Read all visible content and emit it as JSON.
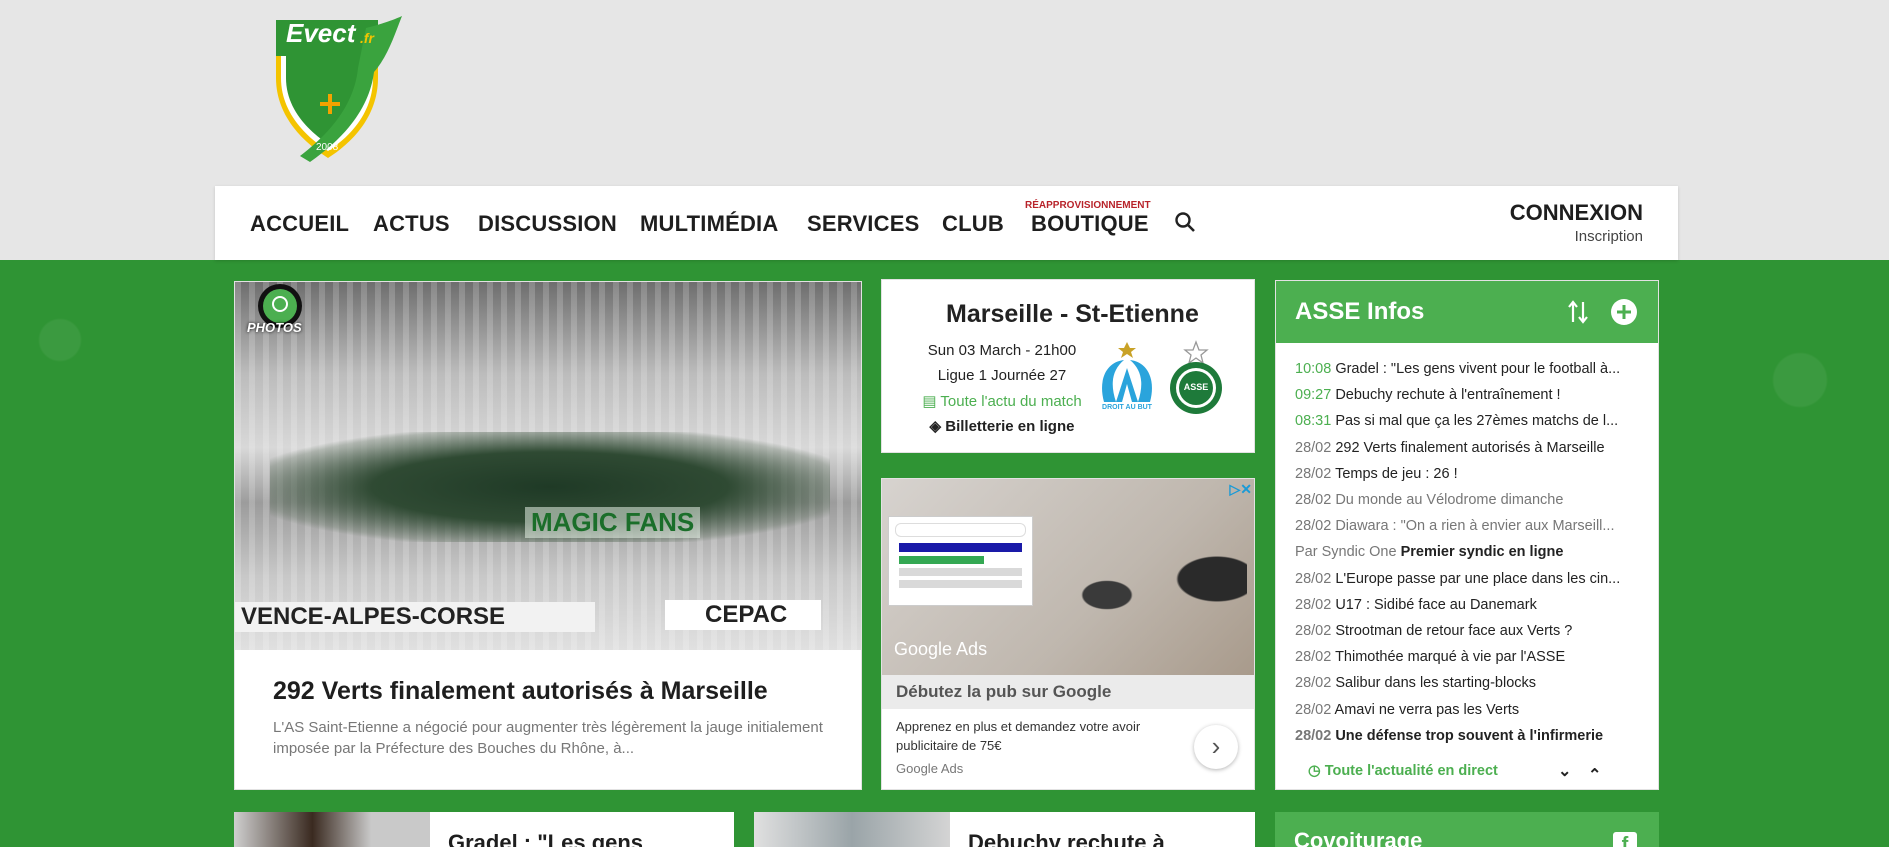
{
  "logo": {
    "text": "Evect",
    "suffix": ".fr",
    "year": "2008"
  },
  "nav": {
    "items": [
      "ACCUEIL",
      "ACTUS",
      "DISCUSSION",
      "MULTIMÉDIA",
      "SERVICES",
      "CLUB",
      "BOUTIQUE"
    ],
    "boutique_badge": "RÉAPPROVISIONNEMENT",
    "login": "CONNEXION",
    "register": "Inscription"
  },
  "featured": {
    "badge": "PHOTOS",
    "banner_left": "VENCE-ALPES-CORSE",
    "banner_right": "CEPAC",
    "crowd_banner": "MAGIC FANS",
    "title": "292 Verts finalement autorisés à Marseille",
    "description": "L'AS Saint-Etienne a négocié pour augmenter très légèrement la jauge initialement imposée par la Préfecture des Bouches du Rhône, à..."
  },
  "match": {
    "title": "Marseille - St-Etienne",
    "date": "Sun 03 March - 21h00",
    "competition": "Ligue 1 Journée 27",
    "news_link": "Toute l'actu du match",
    "ticket_link": "Billetterie en ligne",
    "home_logo_caption": "DROIT AU BUT",
    "away_logo_caption": "ASSE"
  },
  "ad": {
    "brand": "Google Ads",
    "headline": "Débutez la pub sur Google",
    "text": "Apprenez en plus et demandez votre avoir publicitaire de 75€",
    "source": "Google Ads"
  },
  "infos": {
    "title": "ASSE Infos",
    "items": [
      {
        "time": "10:08",
        "title": "Gradel : \"Les gens vivent pour le football à...",
        "green": true
      },
      {
        "time": "09:27",
        "title": "Debuchy rechute à l'entraînement !",
        "green": true
      },
      {
        "time": "08:31",
        "title": "Pas si mal que ça les 27èmes matchs de l...",
        "green": true
      },
      {
        "time": "28/02",
        "title": "292 Verts finalement autorisés à Marseille"
      },
      {
        "time": "28/02",
        "title": "Temps de jeu : 26 !"
      },
      {
        "time": "28/02",
        "title": "Du monde au Vélodrome dimanche",
        "grey": true
      },
      {
        "time": "28/02",
        "title": "Diawara : \"On a rien à envier aux Marseill...",
        "grey": true
      },
      {
        "time": "Par Syndic One",
        "title": "Premier syndic en ligne",
        "sponsor": true
      },
      {
        "time": "28/02",
        "title": "L'Europe passe par une place dans les cin..."
      },
      {
        "time": "28/02",
        "title": "U17 : Sidibé face au Danemark"
      },
      {
        "time": "28/02",
        "title": "Strootman de retour face aux Verts ?"
      },
      {
        "time": "28/02",
        "title": "Thimothée marqué à vie par l'ASSE"
      },
      {
        "time": "28/02",
        "title": "Salibur dans les starting-blocks"
      },
      {
        "time": "28/02",
        "title": "Amavi ne verra pas les Verts"
      },
      {
        "time": "28/02",
        "title": "Une défense trop souvent à l'infirmerie",
        "bold": true
      }
    ],
    "footer_link": "Toute l'actualité en direct"
  },
  "bottom": {
    "card1_title": "Gradel : \"Les gens",
    "card2_title": "Debuchy rechute à",
    "covoit_title": "Covoiturage",
    "fb_glyph": "f"
  },
  "colors": {
    "brand_green": "#4caf50",
    "bg_green": "#2f9434",
    "badge_red": "#b8232a"
  }
}
